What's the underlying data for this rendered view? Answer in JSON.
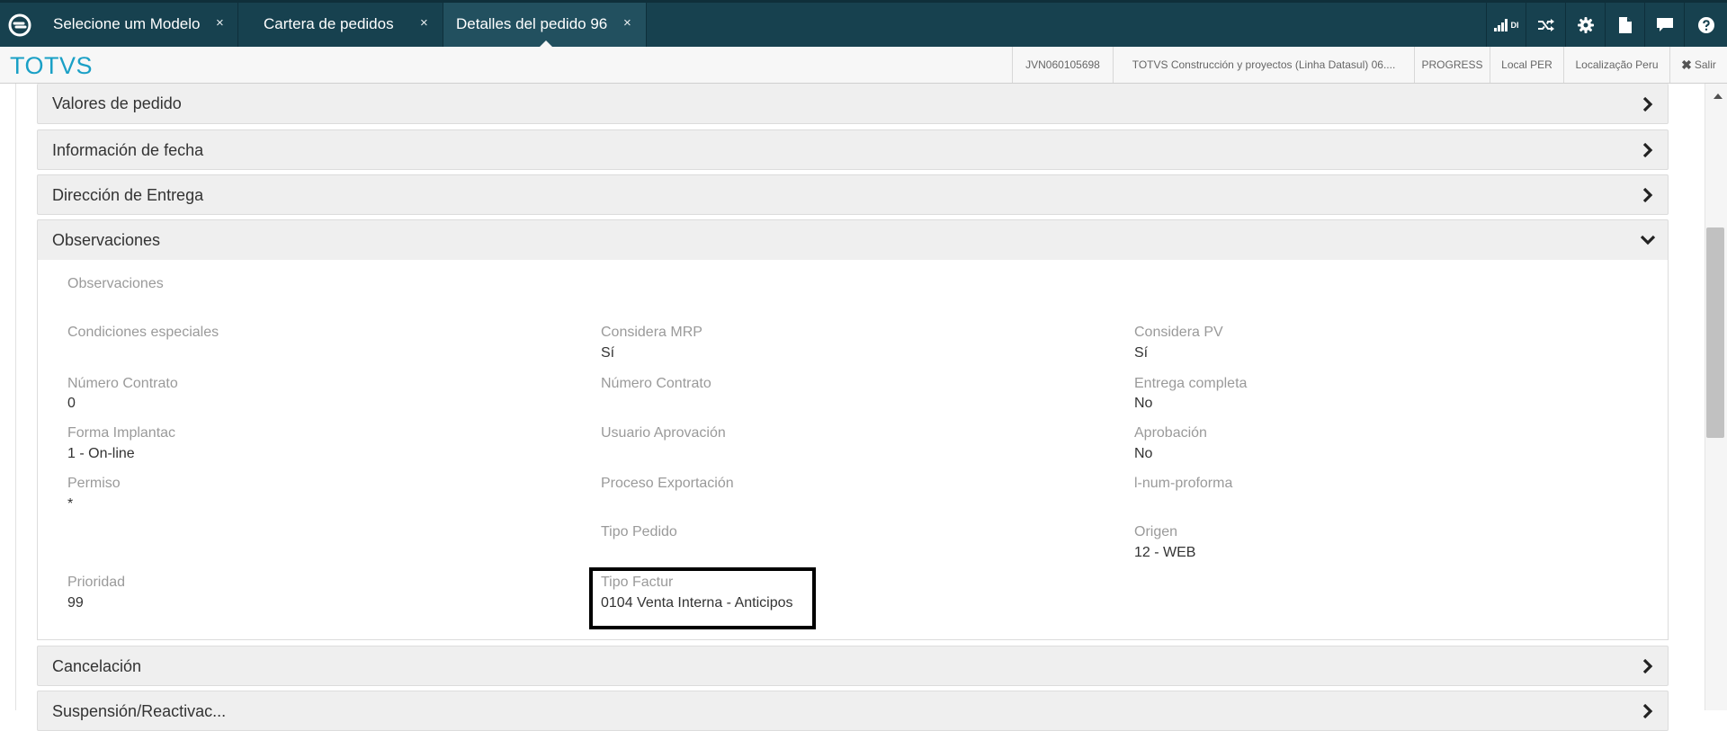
{
  "tabs": [
    {
      "label": "Selecione um Modelo",
      "close": "×"
    },
    {
      "label": "Cartera de pedidos",
      "close": "×"
    },
    {
      "label": "Detalles del pedido 96",
      "close": "×"
    }
  ],
  "topbar_icons": {
    "analytics_label": "DI"
  },
  "brand": "TOTVS",
  "info_bar": {
    "user": "JVN060105698",
    "company": "TOTVS Construcción y proyectos (Linha Datasul) 06....",
    "database": "PROGRESS",
    "local": "Local PER",
    "localization": "Localização Peru",
    "logout": "Salir"
  },
  "sections": {
    "valores": "Valores de pedido",
    "fecha": "Información de fecha",
    "direccion": "Dirección de Entrega",
    "observaciones": "Observaciones",
    "cancelacion": "Cancelación",
    "suspension": "Suspensión/Reactivac..."
  },
  "observaciones": {
    "obs_label": "Observaciones",
    "condiciones_label": "Condiciones especiales",
    "considera_mrp_label": "Considera MRP",
    "considera_mrp_value": "Sí",
    "considera_pv_label": "Considera PV",
    "considera_pv_value": "Sí",
    "numero_contrato_label": "Número Contrato",
    "numero_contrato_value": "0",
    "numero_contrato2_label": "Número Contrato",
    "entrega_completa_label": "Entrega completa",
    "entrega_completa_value": "No",
    "forma_implantac_label": "Forma Implantac",
    "forma_implantac_value": "1 - On-line",
    "usuario_aprovacion_label": "Usuario Aprovación",
    "aprobacion_label": "Aprobación",
    "aprobacion_value": "No",
    "permiso_label": "Permiso",
    "permiso_value": "*",
    "proceso_exportacion_label": "Proceso Exportación",
    "proforma_label": "l-num-proforma",
    "tipo_pedido_label": "Tipo Pedido",
    "origen_label": "Origen",
    "origen_value": "12 - WEB",
    "prioridad_label": "Prioridad",
    "prioridad_value": "99",
    "tipo_factur_label": "Tipo Factur",
    "tipo_factur_value": "0104 Venta Interna - Anticipos"
  }
}
